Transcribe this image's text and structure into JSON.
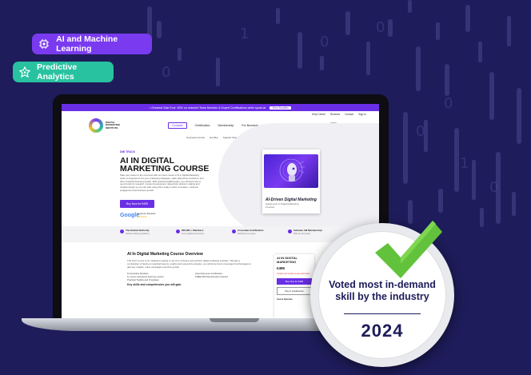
{
  "pills": {
    "ai_ml": "AI and Machine Learning",
    "predictive": "Predictive Analytics"
  },
  "site": {
    "topbar_text": "• Greatest Sale Ever: 60% on selected Team Member & Expert Certifications while spots lat",
    "topbar_button": "View Bundles",
    "util_links": [
      "Help Centre",
      "Reviews",
      "Contact",
      "Sign In"
    ],
    "logo_text": [
      "DIGITAL",
      "MARKETING",
      "INSTITUTE"
    ],
    "nav_links": [
      "Courses",
      "Certification",
      "Membership",
      "For Business",
      "Resources"
    ],
    "signup": "Join Now",
    "subnav": [
      "Overview Course",
      "Get Buy",
      "Support Team",
      "DMI Difference"
    ],
    "hero": {
      "tag": "DMI TRACK",
      "title": "AI IN DIGITAL MARKETING COURSE",
      "desc": "Take your career to the next level with our short course in AI in Digital Marketing. Learn to integrate AI into your marketing strategies, make data-driven decisions, and drive impactful business growth. With practical walkthroughs, you will learn how to use AI tools for research, content development, data-driven decision making and creative design so you can start using them today to drive innovation, customer engagement and business growth.",
      "button": "Buy Now for €495",
      "google_label": "Google",
      "rating_label": "Customer Reviews",
      "stars": "★★★★★"
    },
    "card": {
      "title": "AI-Driven Digital Marketing",
      "subtitle": "Applying AI to Digital Marketing Courses"
    },
    "features": [
      {
        "title": "The Global Authority",
        "sub": "Global certifying academy"
      },
      {
        "title": "200,000 + Members",
        "sub": "Join a global community"
      },
      {
        "title": "Associate Certification",
        "sub": "Global by our peers"
      },
      {
        "title": "Includes 1M Membership",
        "sub": "With we all course"
      }
    ],
    "overview": {
      "title": "AI In Digital Marketing Course Overview",
      "text": "This short course is for marketers looking to use AI to enhance and optimize digital marketing activities. Through a combination of hands-on practical lessons, toolkits and real-world examples, you will know how to leverage AI technologies to gain key insights, refine campaigns and drive growth.",
      "list_left": [
        "8 Interactive Modules",
        "5+ Hours self-paced learning content",
        "Practical Toolkits and Templates"
      ],
      "list_right": [
        "Associate-level Certification",
        "FREE DMI Membership Included"
      ],
      "key_skills": "Key skills and competencies you will gain"
    },
    "side": {
      "title": "AI IN DIGITAL MARKETING",
      "price": "€495",
      "note": "Contact your location to get price listed",
      "buy": "Buy Now for €495",
      "pay": "Pay in installments",
      "course_overview": "Course Overview"
    }
  },
  "badge": {
    "text_line1": "Voted most in-demand",
    "text_line2": "skill by the industry",
    "year": "2024"
  }
}
